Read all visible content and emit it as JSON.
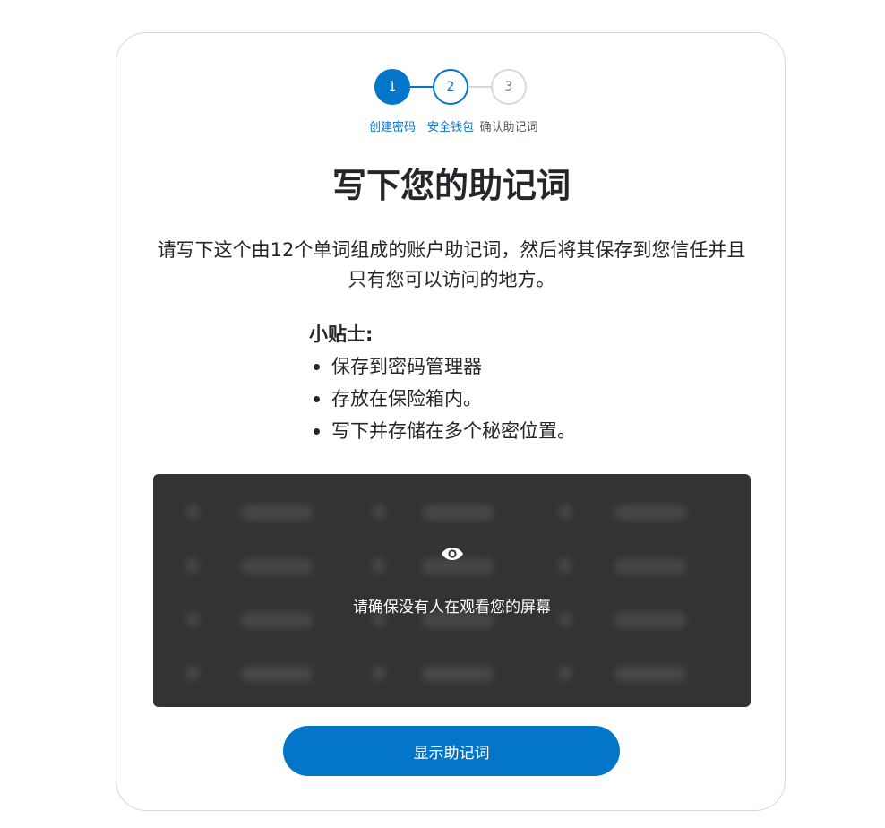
{
  "stepper": {
    "steps": [
      {
        "number": "1",
        "label": "创建密码",
        "state": "completed"
      },
      {
        "number": "2",
        "label": "安全钱包",
        "state": "active"
      },
      {
        "number": "3",
        "label": "确认助记词",
        "state": "pending"
      }
    ]
  },
  "main": {
    "title": "写下您的助记词",
    "description": "请写下这个由12个单词组成的账户助记词，然后将其保存到您信任并且只有您可以访问的地方。",
    "tips": {
      "title": "小贴士:",
      "items": [
        "保存到密码管理器",
        "存放在保险箱内。",
        "写下并存储在多个秘密位置。"
      ]
    },
    "srp": {
      "icon": "eye-icon",
      "warning": "请确保没有人在观看您的屏幕"
    },
    "reveal_button_label": "显示助记词"
  },
  "colors": {
    "primary": "#0376c9",
    "srp_background": "#333333",
    "inactive_step": "#d6d9dc"
  }
}
